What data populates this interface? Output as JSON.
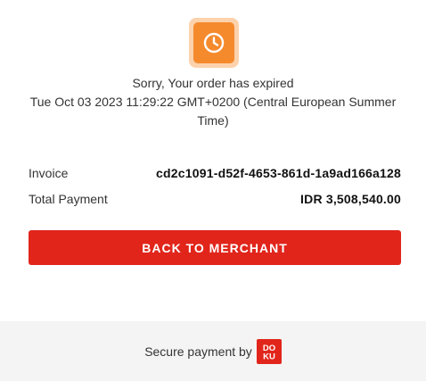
{
  "status": {
    "icon": "clock-icon",
    "message": "Sorry, Your order has expired",
    "expired_at": "Tue Oct 03 2023 11:29:22 GMT+0200 (Central European Summer Time)"
  },
  "details": {
    "invoice_label": "Invoice",
    "invoice_value": "cd2c1091-d52f-4653-861d-1a9ad166a128",
    "total_label": "Total Payment",
    "total_value": "IDR 3,508,540.00"
  },
  "actions": {
    "back_label": "BACK TO MERCHANT"
  },
  "footer": {
    "secure_text": "Secure payment by",
    "logo": "DOKU"
  },
  "colors": {
    "accent_red": "#e1251b",
    "warning_orange": "#f58a2d",
    "warning_orange_light": "#fcd2ac",
    "footer_bg": "#f4f4f4"
  }
}
